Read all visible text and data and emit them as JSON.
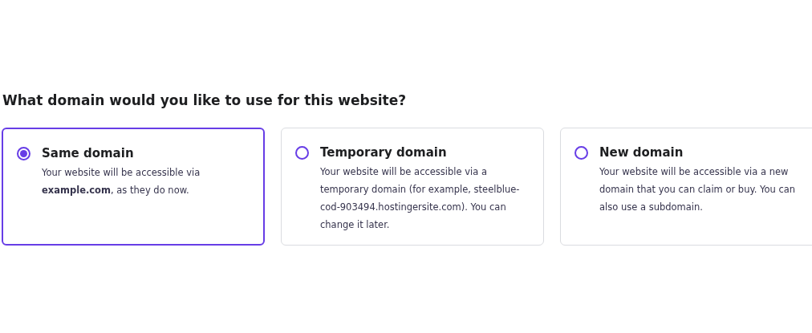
{
  "question": "What domain would you like to use for this website?",
  "options": [
    {
      "title": "Same domain",
      "description": "Your website will be accessible via **example.com**, as they do now.",
      "selected": true
    },
    {
      "title": "Temporary domain",
      "description": "Your website will be accessible via a temporary domain (for example, steelblue-cod-903494.hostingersite.com). You can change it later.",
      "selected": false
    },
    {
      "title": "New domain",
      "description": "Your website will be accessible via a new domain that you can claim or buy. You can also use a subdomain.",
      "selected": false
    }
  ]
}
